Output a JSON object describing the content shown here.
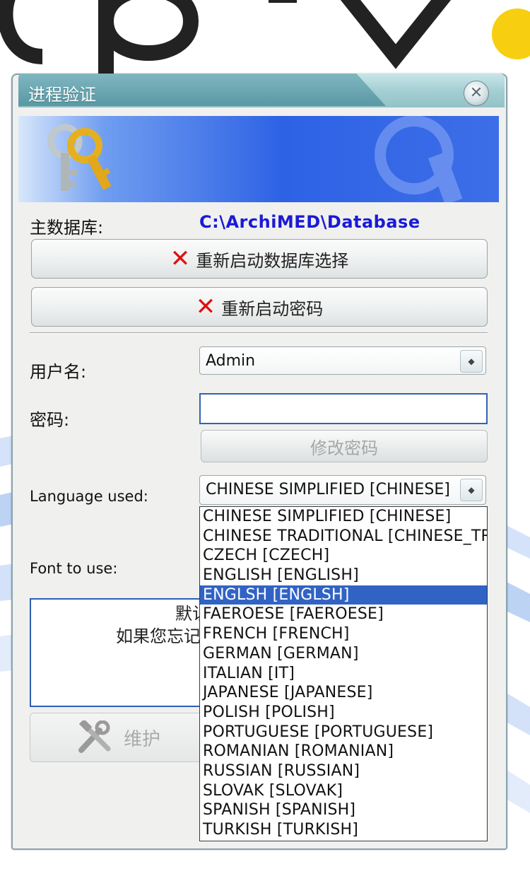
{
  "window": {
    "title": "进程验证"
  },
  "database": {
    "label": "主数据库:",
    "path": "C:\\ArchiMED\\Database"
  },
  "buttons": {
    "restart_db": "重新启动数据库选择",
    "restart_password": "重新启动密码",
    "change_password": "修改密码",
    "maintenance": "维护"
  },
  "form": {
    "username_label": "用户名:",
    "username_value": "Admin",
    "password_label": "密码:",
    "password_value": "",
    "language_label": "Language used:",
    "language_value": "CHINESE SIMPLIFIED [CHINESE]",
    "font_label": "Font to use:"
  },
  "info": {
    "line1": "默认",
    "line2": "如果您忘记"
  },
  "language_options": [
    "CHINESE SIMPLIFIED [CHINESE]",
    "CHINESE TRADITIONAL [CHINESE_TRADITIONAL]",
    "CZECH [CZECH]",
    "ENGLISH [ENGLISH]",
    "ENGLSH [ENGLSH]",
    "FAEROESE [FAEROESE]",
    "FRENCH [FRENCH]",
    "GERMAN [GERMAN]",
    "ITALIAN [IT]",
    "JAPANESE [JAPANESE]",
    "POLISH [POLISH]",
    "PORTUGUESE [PORTUGUESE]",
    "ROMANIAN [ROMANIAN]",
    "RUSSIAN [RUSSIAN]",
    "SLOVAK [SLOVAK]",
    "SPANISH [SPANISH]",
    "TURKISH [TURKISH]"
  ],
  "highlighted_option": "ENGLSH [ENGLSH]",
  "colors": {
    "accent": "#3163c5",
    "path_text": "#1a1ad6",
    "error_x": "#e01010",
    "title_bar": "#7fb7c0"
  },
  "icons": {
    "close": "close-icon",
    "keys": "keys-icon",
    "error": "x-icon",
    "tools": "tools-icon"
  }
}
